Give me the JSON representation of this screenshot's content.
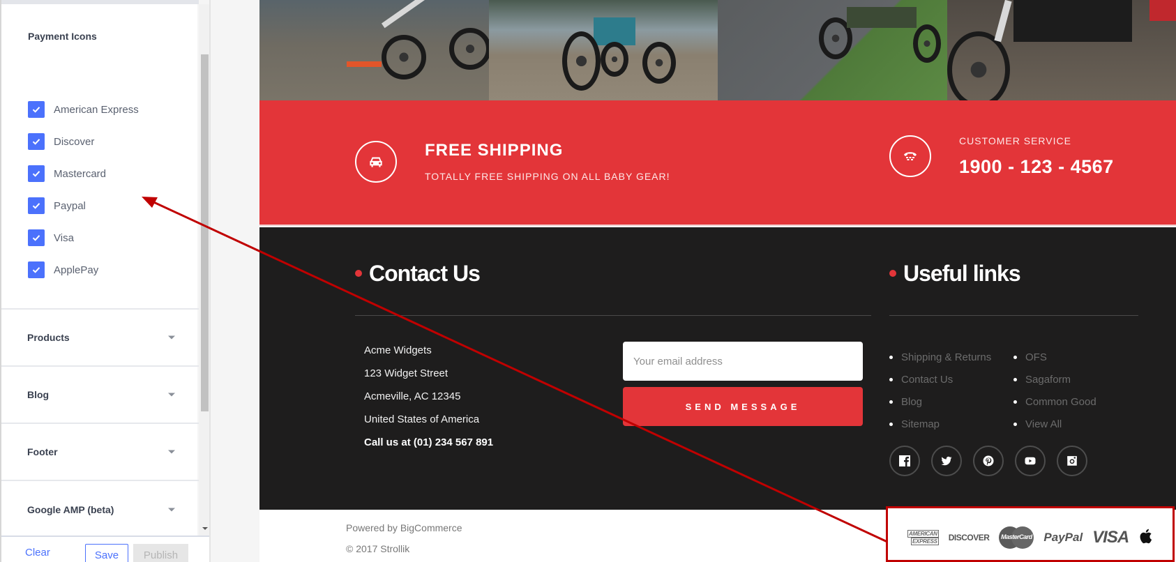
{
  "sidebar": {
    "payment_section": {
      "title": "Payment Icons",
      "expanded": true,
      "options": [
        {
          "label": "American Express",
          "checked": true
        },
        {
          "label": "Discover",
          "checked": true
        },
        {
          "label": "Mastercard",
          "checked": true
        },
        {
          "label": "Paypal",
          "checked": true
        },
        {
          "label": "Visa",
          "checked": true
        },
        {
          "label": "ApplePay",
          "checked": true
        }
      ]
    },
    "sections": [
      {
        "title": "Products",
        "expanded": false
      },
      {
        "title": "Blog",
        "expanded": false
      },
      {
        "title": "Footer",
        "expanded": false
      },
      {
        "title": "Google AMP (beta)",
        "expanded": false
      }
    ],
    "actions": {
      "clear_label": "Clear",
      "save_label": "Save",
      "publish_label": "Publish",
      "publish_disabled": true
    }
  },
  "preview": {
    "promo": {
      "shipping_title": "FREE SHIPPING",
      "shipping_subtitle": "TOTALLY FREE SHIPPING ON ALL BABY GEAR!",
      "service_title": "CUSTOMER SERVICE",
      "service_phone": "1900 - 123 - 4567"
    },
    "contact": {
      "heading": "Contact Us",
      "address_lines": [
        "Acme Widgets",
        "123 Widget Street",
        "Acmeville, AC 12345",
        "United States of America"
      ],
      "call_line": "Call us at (01) 234 567 891",
      "email_placeholder": "Your email address",
      "email_value": "",
      "send_label": "SEND MESSAGE"
    },
    "useful_links": {
      "heading": "Useful links",
      "column1": [
        "Shipping & Returns",
        "Contact Us",
        "Blog",
        "Sitemap"
      ],
      "column2": [
        "OFS",
        "Sagaform",
        "Common Good",
        "View All"
      ]
    },
    "socials": [
      {
        "name": "facebook-icon"
      },
      {
        "name": "twitter-icon"
      },
      {
        "name": "pinterest-icon"
      },
      {
        "name": "youtube-icon"
      },
      {
        "name": "instagram-icon"
      }
    ],
    "footer_bottom": {
      "powered_by": "Powered by BigCommerce",
      "copyright": "© 2017 Strollik"
    },
    "payment_icons": {
      "amex_line1": "AMERICAN",
      "amex_line2": "EXPRESS",
      "discover": "DISCOVER",
      "mastercard": "MasterCard",
      "paypal": "PayPal",
      "visa": "VISA"
    }
  },
  "colors": {
    "accent_red": "#e33539",
    "checkbox_blue": "#4b71fc",
    "footer_dark": "#1e1d1d",
    "annotation_red": "#c00000"
  }
}
